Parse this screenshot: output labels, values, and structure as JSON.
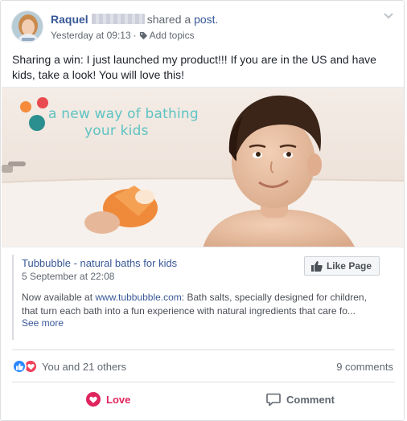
{
  "post": {
    "author_name": "Raquel",
    "shared_text": "shared a",
    "post_link": "post.",
    "timestamp": "Yesterday at 09:13",
    "separator": "·",
    "add_topics": "Add topics",
    "text": "Sharing a win: I just launched my product!!! If you are in the US and have kids, take a look! You will love this!"
  },
  "image": {
    "tagline_line1": "a new way of bathing",
    "tagline_line2": "your kids",
    "dot_colors": [
      "#f58b3a",
      "#e84a4f",
      "#2a8f8e"
    ],
    "tagline_color": "#5ec3c2"
  },
  "link_preview": {
    "title": "Tubbubble - natural baths for kids",
    "date": "5 September at 22:08",
    "like_page_label": "Like Page",
    "desc_prefix": "Now available at ",
    "desc_url": "www.tubbubble.com",
    "desc_line1_rest": ": Bath salts, specially designed for children,",
    "desc_line2": "that turn each bath into a fun experience with natural ingredients that care fo...",
    "see_more": "See more"
  },
  "engagement": {
    "reactions_text": "You and 21 others",
    "comments_count": "9 comments",
    "reaction_icons": [
      "like-icon",
      "love-icon"
    ],
    "like_color": "#2d88ff",
    "love_color": "#f0405c"
  },
  "actions": {
    "love_label": "Love",
    "comment_label": "Comment",
    "love_color": "#e0245e"
  }
}
